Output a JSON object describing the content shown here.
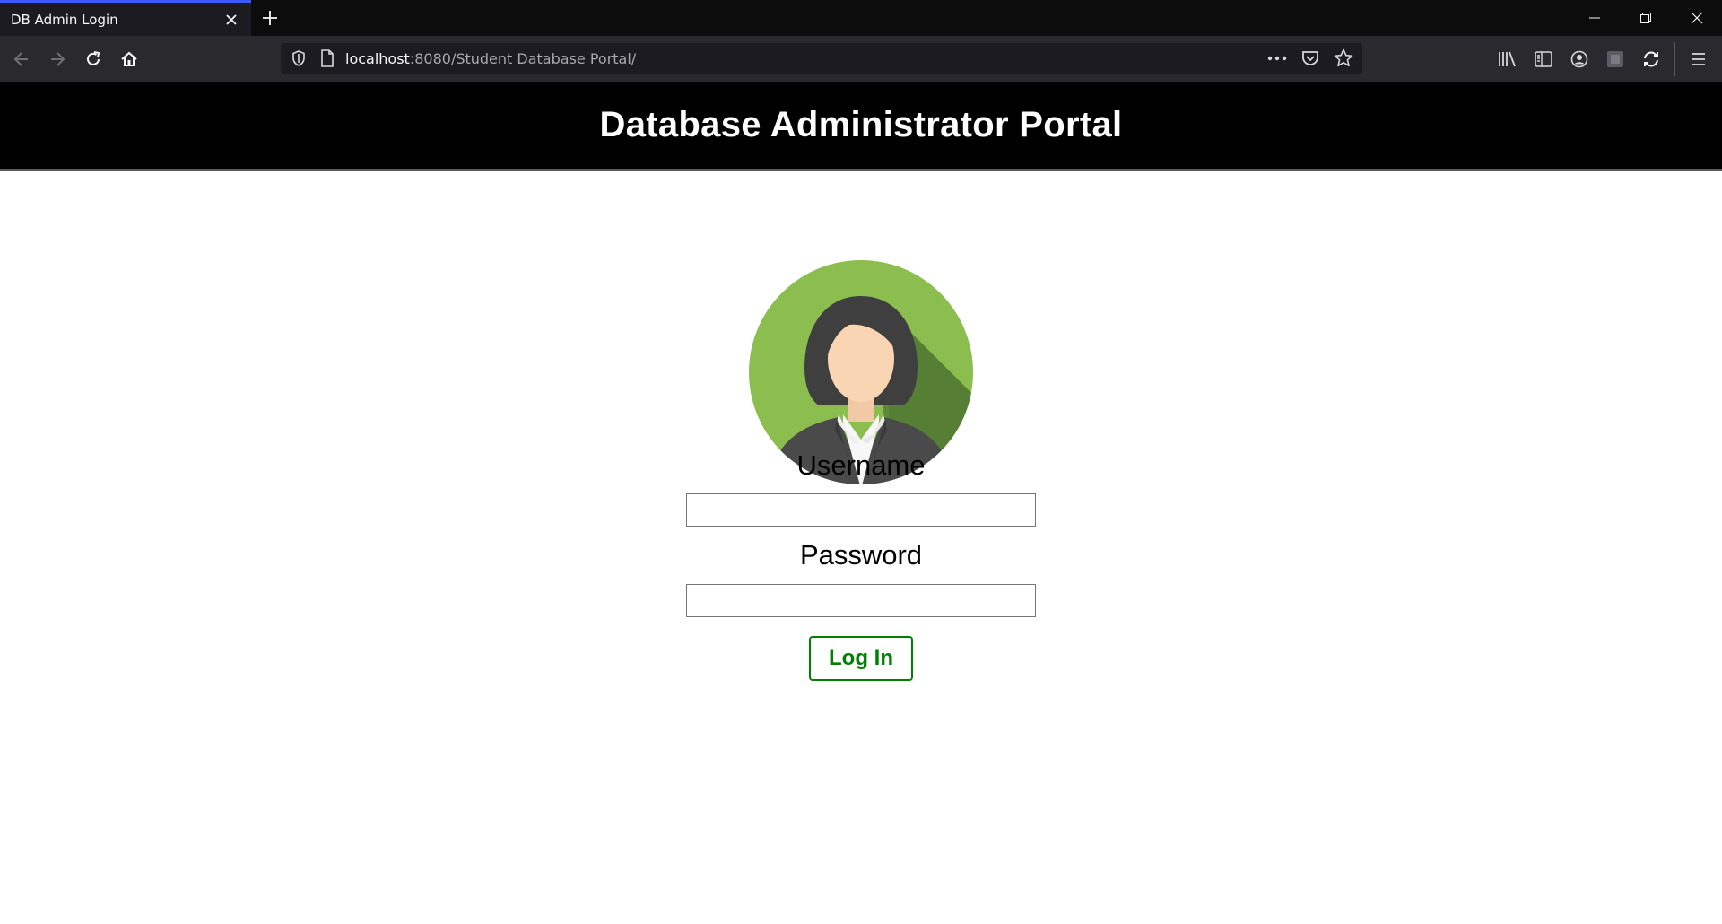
{
  "browser": {
    "tab": {
      "title": "DB Admin Login"
    },
    "url": {
      "host": "localhost",
      "rest": ":8080/Student Database Portal/"
    },
    "accent_color": "#3d5afe"
  },
  "page": {
    "header_title": "Database Administrator Portal",
    "avatar_icon": "female-administrator-avatar",
    "username_label": "Username",
    "username_value": "",
    "password_label": "Password",
    "password_value": "",
    "login_button": "Log In",
    "button_color": "#008000",
    "avatar_bg_color": "#8bbd4f"
  }
}
